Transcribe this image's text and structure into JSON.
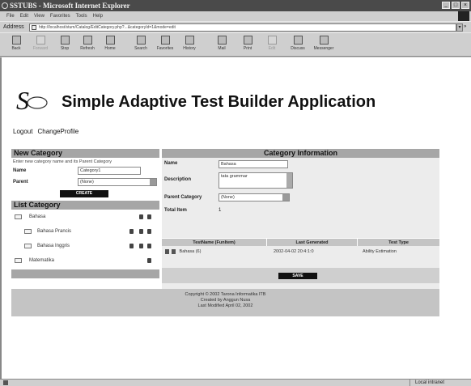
{
  "window": {
    "title": "SSTUBS - Microsoft Internet Explorer",
    "menu": [
      "File",
      "Edit",
      "View",
      "Favorites",
      "Tools",
      "Help"
    ]
  },
  "address": {
    "label": "Address",
    "url": "http://localhost/stum/Catalog/EditCategory.php?...&categoryId=1&mode=edit"
  },
  "toolbar": {
    "buttons": [
      "Back",
      "Forward",
      "Stop",
      "Refresh",
      "Home",
      "Search",
      "Favorites",
      "History",
      "Mail",
      "Print",
      "Edit",
      "Discuss",
      "Messenger"
    ]
  },
  "app": {
    "logo_text": "Stum",
    "title": "Simple Adaptive Test Builder Application",
    "links": [
      "Logout",
      "ChangeProfile"
    ]
  },
  "new_category": {
    "header": "New Category",
    "hint": "Enter new category name and its Parent Category",
    "name_label": "Name",
    "name_value": "Category1",
    "parent_label": "Parent",
    "parent_value": "(None)",
    "create_label": "CREATE"
  },
  "list_category": {
    "header": "List Category",
    "items": [
      {
        "name": "Bahasa"
      },
      {
        "name": "Bahasa Prancis"
      },
      {
        "name": "Bahasa Inggris"
      },
      {
        "name": "Matematika"
      }
    ]
  },
  "category_info": {
    "header": "Category Information",
    "name_label": "Name",
    "name_value": "Bahasa",
    "description_label": "Description",
    "description_value": "tata grammar",
    "parent_label": "Parent Category",
    "parent_value": "(None)",
    "total_label": "Total Item",
    "total_value": "1"
  },
  "tests_table": {
    "columns": [
      "TestName (FunItem)",
      "Last Generated",
      "Test Type"
    ],
    "rows": [
      {
        "name": "Bahasa (6)",
        "last_generated": "2002-04-02 20:4:1:0",
        "type": "Ability Estimation"
      }
    ]
  },
  "save_label": "SAVE",
  "footer": {
    "lines": [
      "Copyright © 2002 Tarona Informatika ITB",
      "Created by Anggun Nusa",
      "Last Modified April 02, 2002"
    ]
  },
  "status": {
    "zone": "Local intranet"
  }
}
